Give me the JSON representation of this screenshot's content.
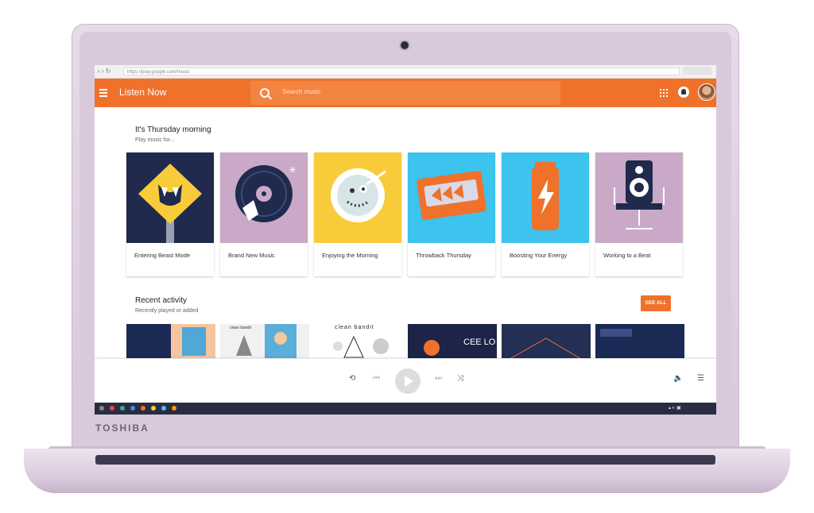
{
  "device": {
    "brand": "TOSHIBA"
  },
  "browser": {
    "url": "https://play.google.com/music"
  },
  "topbar": {
    "title": "Listen Now",
    "search_placeholder": "Search music"
  },
  "greeting": {
    "title": "It's Thursday morning",
    "subtitle": "Play music for..."
  },
  "cards": [
    {
      "label": "Entering Beast Mode",
      "bg": "#1f2a4d"
    },
    {
      "label": "Brand New Music",
      "bg": "#c9a9c7"
    },
    {
      "label": "Enjoying the Morning",
      "bg": "#f8cb3a"
    },
    {
      "label": "Throwback Thursday",
      "bg": "#3cc3ee"
    },
    {
      "label": "Boosting Your Energy",
      "bg": "#3cc3ee"
    },
    {
      "label": "Working to a Beat",
      "bg": "#c9a9c7"
    }
  ],
  "recent": {
    "title": "Recent activity",
    "subtitle": "Recently played or added",
    "see_all": "SEE ALL",
    "albums": [
      {
        "caption": "",
        "bg": "#1b2a55"
      },
      {
        "caption": "clean bandit",
        "bg": "#f1f1f1"
      },
      {
        "caption": "clean bandit",
        "bg": "#ffffff"
      },
      {
        "caption": "",
        "bg": "#1c2447"
      },
      {
        "caption": "",
        "bg": "#233056"
      },
      {
        "caption": "",
        "bg": "#1b2a55"
      }
    ]
  },
  "colors": {
    "accent": "#f0712a"
  }
}
